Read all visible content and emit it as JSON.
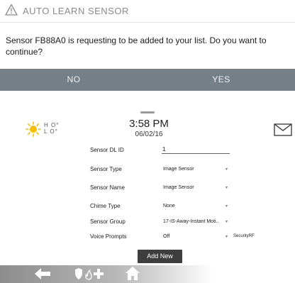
{
  "dialog": {
    "title": "AUTO LEARN SENSOR",
    "message": "Sensor FB88A0 is requesting to be added to your list. Do you want to continue?",
    "no_label": "NO",
    "yes_label": "YES"
  },
  "header": {
    "weather_hi": "H O°",
    "weather_lo": "L O°",
    "time": "3:58 PM",
    "date": "06/02/16"
  },
  "form": {
    "dlid_label": "Sensor DL ID",
    "dlid_value": "1",
    "type_label": "Sensor Type",
    "type_value": "Image Sensor",
    "name_label": "Sensor Name",
    "name_value": "Image Sensor",
    "chime_label": "Chime Type",
    "chime_value": "None",
    "group_label": "Sensor Group",
    "group_value": "17-IS-Away-Instant Moti..",
    "voice_label": "Voice Prompts",
    "voice_value": "Off",
    "voice_extra": "SecurityRF",
    "caret": "▾",
    "add_label": "Add New"
  },
  "colors": {
    "button_bar": "#757f87",
    "sun": "#f5c000",
    "add_button": "#3e3e3e"
  },
  "icons": [
    "warning-icon",
    "sun-icon",
    "mail-icon",
    "back-arrow-icon",
    "shield-icon",
    "flame-icon",
    "medical-cross-icon",
    "home-icon"
  ]
}
